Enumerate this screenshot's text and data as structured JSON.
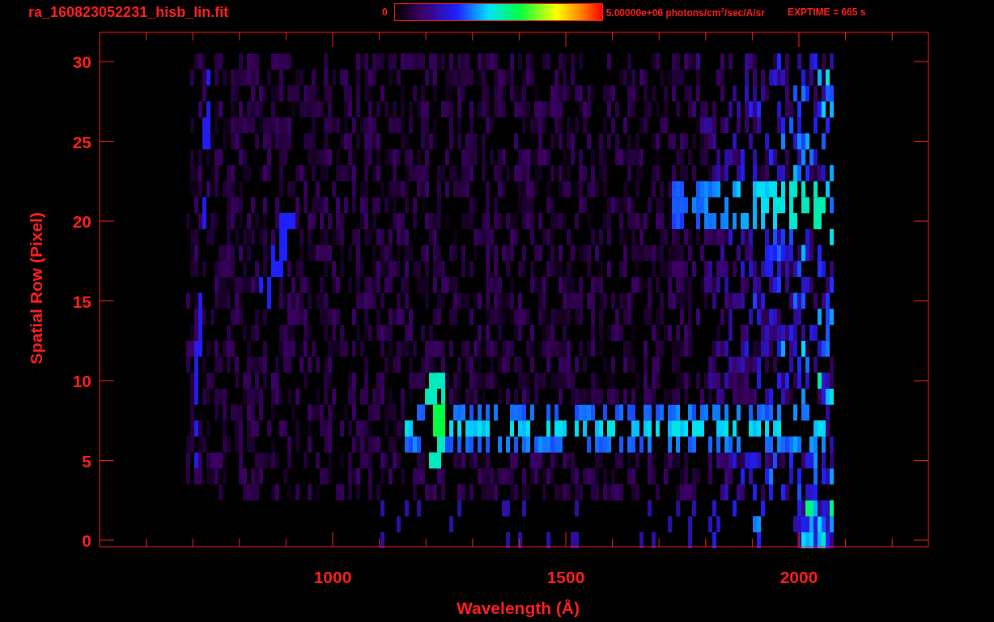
{
  "header": {
    "file_name": "ra_160823052231_hisb_lin.fit",
    "colorbar_min": "0",
    "colorbar_max": "5.00000e+06 photons/cm$^{2}$/sec/A/sr",
    "exposure": "EXPTIME = 665 s"
  },
  "plot": {
    "x_axis": {
      "label": "Wavelength (Å)",
      "tick_labels": [
        "1000",
        "1500",
        "2000"
      ]
    },
    "y_axis": {
      "label": "Spatial Row (Pixel)",
      "tick_labels": [
        "30",
        "25",
        "20",
        "15",
        "10",
        "5",
        "0"
      ]
    }
  }
}
